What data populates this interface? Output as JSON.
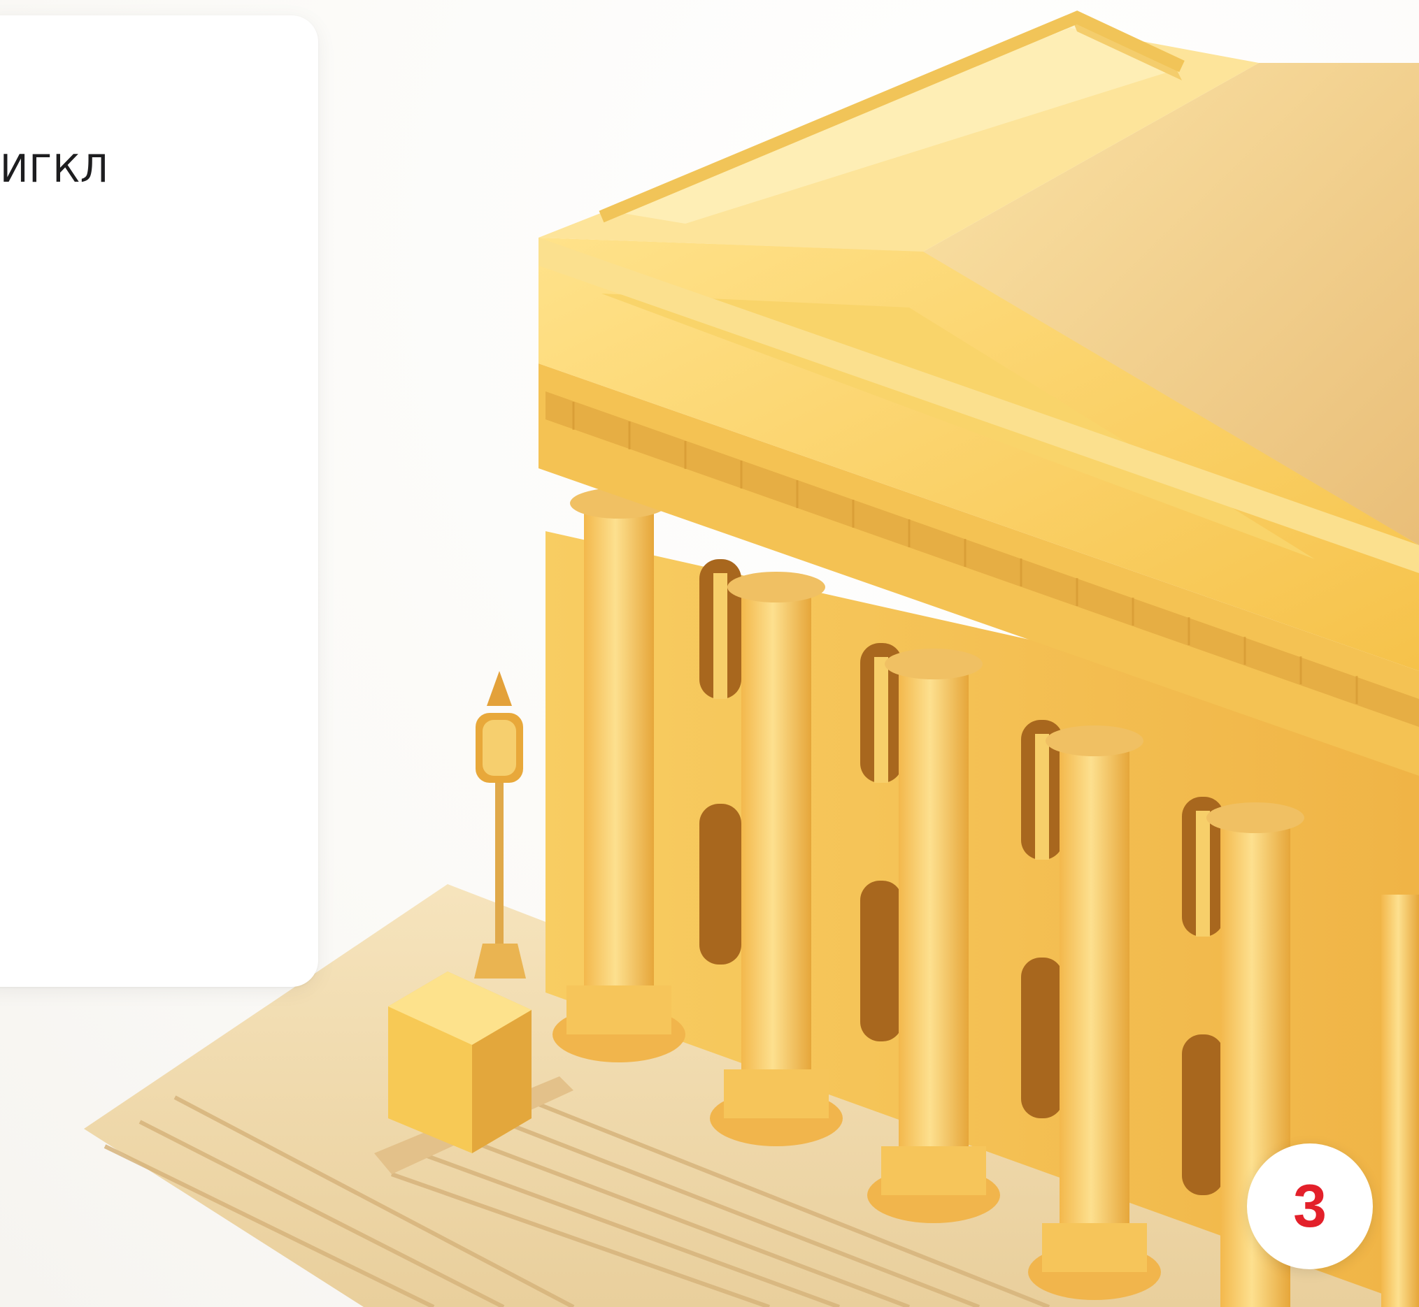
{
  "card": {
    "title": "ИГКЛ"
  },
  "badge": {
    "number": "3"
  },
  "illustration": {
    "icon": "classical-building-icon"
  },
  "colors": {
    "badge_accent": "#e3202a",
    "building_gold": "#f6c94a",
    "building_light": "#fde79a",
    "building_shadow": "#d79a36",
    "stairs": "#efd9ae",
    "background": "#fbfaf8"
  }
}
